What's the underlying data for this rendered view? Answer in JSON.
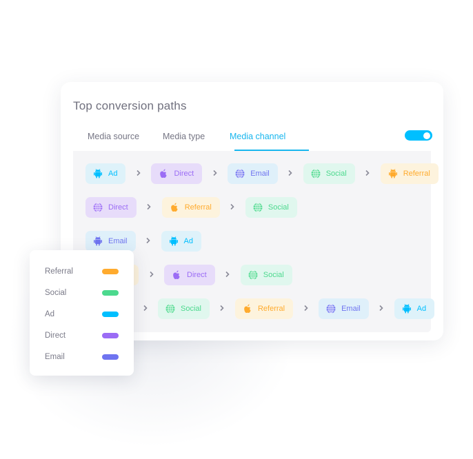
{
  "title": "Top conversion paths",
  "tabs": [
    {
      "label": "Media source",
      "active": false
    },
    {
      "label": "Media type",
      "active": false
    },
    {
      "label": "Media channel",
      "active": true
    }
  ],
  "toggle": {
    "on": true,
    "color": "#00bfff"
  },
  "channels": {
    "Ad": {
      "color": "#00bfff",
      "bg": "#def2fa",
      "icon": "android-icon"
    },
    "Direct": {
      "color": "#9b6cf5",
      "bg": "#e7dcfa",
      "icon": "apple-icon"
    },
    "Email": {
      "color": "#6f74f0",
      "bg": "#dff0fa",
      "icon": "globe-icon"
    },
    "Social": {
      "color": "#4cd98e",
      "bg": "#e0f7ee",
      "icon": "globe-icon"
    },
    "Referral": {
      "color": "#ffab2e",
      "bg": "#fdf3dd",
      "icon": "apple-icon"
    }
  },
  "paths": [
    [
      {
        "label": "Ad",
        "type": "Ad",
        "icon": "android-icon"
      },
      {
        "label": "Direct",
        "type": "Direct",
        "icon": "apple-icon"
      },
      {
        "label": "Email",
        "type": "Email",
        "icon": "globe-icon"
      },
      {
        "label": "Social",
        "type": "Social",
        "icon": "globe-icon"
      },
      {
        "label": "Referral",
        "type": "Referral",
        "icon": "android-icon"
      }
    ],
    [
      {
        "label": "Direct",
        "type": "Direct",
        "icon": "globe-icon"
      },
      {
        "label": "Referral",
        "type": "Referral",
        "icon": "apple-icon"
      },
      {
        "label": "Social",
        "type": "Social",
        "icon": "globe-icon"
      }
    ],
    [
      {
        "label": "Email",
        "type": "Email",
        "icon": "android-icon"
      },
      {
        "label": "Ad",
        "type": "Ad",
        "icon": "android-icon"
      }
    ],
    [
      {
        "type": "Referral",
        "hidden": true
      },
      {
        "label": "Direct",
        "type": "Direct",
        "icon": "apple-icon"
      },
      {
        "label": "Social",
        "type": "Social",
        "icon": "globe-icon"
      }
    ],
    [
      {
        "type": "Email",
        "hidden": true
      },
      {
        "label": "Social",
        "type": "Social",
        "icon": "globe-icon"
      },
      {
        "label": "Referral",
        "type": "Referral",
        "icon": "apple-icon"
      },
      {
        "label": "Email",
        "type": "Email",
        "icon": "globe-icon"
      },
      {
        "label": "Ad",
        "type": "Ad",
        "icon": "android-icon"
      }
    ]
  ],
  "legend": [
    {
      "label": "Referral",
      "color": "#ffab2e"
    },
    {
      "label": "Social",
      "color": "#4cd98e"
    },
    {
      "label": "Ad",
      "color": "#00bfff"
    },
    {
      "label": "Direct",
      "color": "#9b6cf5"
    },
    {
      "label": "Email",
      "color": "#6f74f0"
    }
  ]
}
